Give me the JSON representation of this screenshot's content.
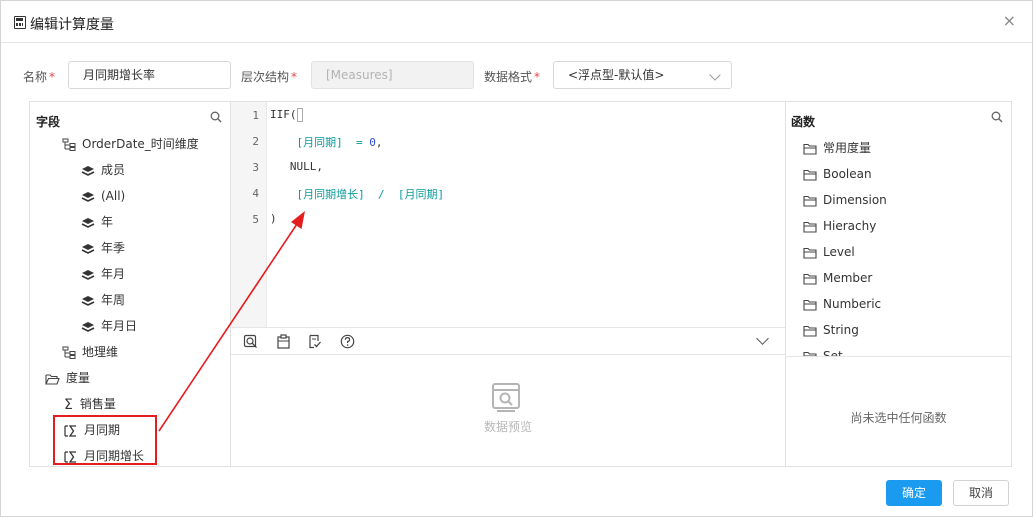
{
  "dialog": {
    "title": "编辑计算度量",
    "close": "×"
  },
  "form": {
    "name_label": "名称",
    "name_value": "月同期增长率",
    "hierarchy_label": "层次结构",
    "hierarchy_value": "[Measures]",
    "format_label": "数据格式",
    "format_value": "<浮点型-默认值>",
    "required_mark": "*"
  },
  "fields_panel": {
    "title": "字段",
    "items": [
      {
        "label": "OrderDate_时间维度",
        "icon": "hierarchy-icon"
      },
      {
        "label": "成员",
        "icon": "layers-icon"
      },
      {
        "label": "(All)",
        "icon": "layers-icon"
      },
      {
        "label": "年",
        "icon": "layers-icon"
      },
      {
        "label": "年季",
        "icon": "layers-icon"
      },
      {
        "label": "年月",
        "icon": "layers-icon"
      },
      {
        "label": "年周",
        "icon": "layers-icon"
      },
      {
        "label": "年月日",
        "icon": "layers-icon"
      },
      {
        "label": "地理维",
        "icon": "hierarchy-icon"
      },
      {
        "label": "度量",
        "icon": "folder-open-icon"
      },
      {
        "label": "销售量",
        "icon": "sigma-icon"
      },
      {
        "label": "月同期",
        "icon": "calc-measure-icon"
      },
      {
        "label": "月同期增长",
        "icon": "calc-measure-icon"
      }
    ]
  },
  "editor": {
    "line_numbers": [
      "1",
      "2",
      "3",
      "4",
      "5"
    ],
    "lines": {
      "l1": "IIF(",
      "l2_field": "[月同期]",
      "l2_op": "= ",
      "l2_num": "0",
      "l2_end": ",",
      "l3": "NULL,",
      "l4_field1": "[月同期增长]",
      "l4_op": "/",
      "l4_field2": "[月同期]",
      "l5": ")"
    }
  },
  "toolbar": {
    "icons": [
      "query-icon",
      "clipboard-icon",
      "check-format-icon",
      "help-icon",
      "chevron-down-icon"
    ]
  },
  "preview": {
    "label": "数据预览"
  },
  "functions_panel": {
    "title": "函数",
    "items": [
      "常用度量",
      "Boolean",
      "Dimension",
      "Hierachy",
      "Level",
      "Member",
      "Numberic",
      "String",
      "Set"
    ],
    "empty_text": "尚未选中任何函数"
  },
  "buttons": {
    "ok": "确定",
    "cancel": "取消"
  },
  "annotation_color": "#e41e1e",
  "accent_color": "#1a9bf0"
}
